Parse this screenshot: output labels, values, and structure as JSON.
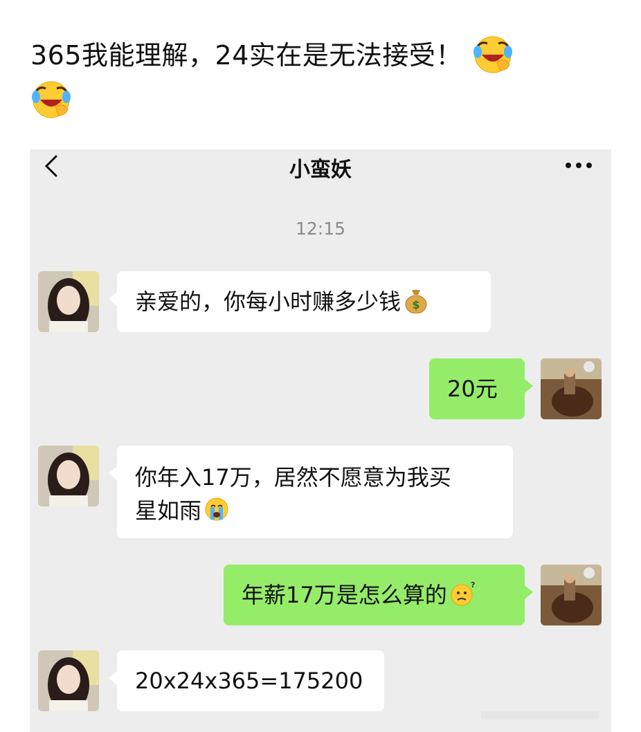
{
  "post": {
    "caption": "365我能理解，24实在是无法接受！",
    "emoji_icon": "laughing-crying-face-icon"
  },
  "chat": {
    "contact_name": "小蛮妖",
    "back_icon": "chevron-left-icon",
    "more_icon": "more-dots-icon",
    "timestamp": "12:15",
    "messages": [
      {
        "from": "contact",
        "text": "亲爱的，你每小时赚多少钱",
        "emoji": "money-bag-icon"
      },
      {
        "from": "me",
        "text": "20元"
      },
      {
        "from": "contact",
        "line1": "你年入17万，居然不愿意为我买",
        "line2": "星如雨",
        "emoji": "crying-face-icon"
      },
      {
        "from": "me",
        "text": "年薪17万是怎么算的",
        "emoji": "confused-face-icon"
      },
      {
        "from": "contact",
        "text": "20x24x365=175200"
      }
    ]
  },
  "colors": {
    "chat_background": "#ededed",
    "incoming_bubble": "#ffffff",
    "outgoing_bubble": "#95ec69"
  }
}
